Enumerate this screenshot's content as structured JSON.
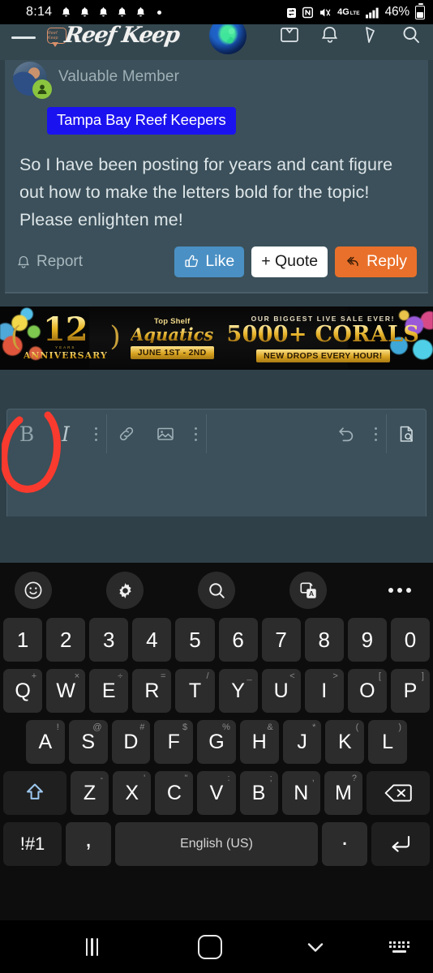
{
  "status_bar": {
    "time": "8:14",
    "notification_icons": [
      "bell-icon",
      "bell-icon",
      "bell-icon",
      "bell-icon",
      "bell-icon",
      "dot-icon"
    ],
    "right_icons": [
      "screen-recorder-icon",
      "nfc-icon",
      "vibrate-mute-icon",
      "4g-lte-icon",
      "signal-bars-icon"
    ],
    "battery_percent": "46%",
    "network_label": "4G",
    "network_sub": "LTE",
    "nfc_label": "N"
  },
  "app_header": {
    "menu_icon": "hamburger-icon",
    "logo_text": "Reef Keep",
    "logo_badge_text": "Reef Keep",
    "globe_icon": "globe-icon",
    "right_icons": [
      "inbox-icon",
      "notification-bell-icon",
      "activity-icon",
      "search-icon"
    ]
  },
  "post": {
    "member_title": "Valuable Member",
    "group_badge": "Tampa Bay Reef Keepers",
    "body": "So I have been posting for years and cant figure out how to make the letters bold for the topic! Please enlighten me!",
    "report_label": "Report",
    "like_label": "Like",
    "quote_label": "+ Quote",
    "reply_label": "Reply",
    "badge_color": "#1b12f0",
    "like_color": "#4a90c4",
    "reply_color": "#e9702a"
  },
  "ad": {
    "years_number": "12",
    "years_word": "YEARS",
    "anniversary": "ANNIVERSARY",
    "brand_top": "Top Shelf",
    "brand_main": "Aquatics",
    "brand_ribbon": "JUNE 1ST - 2ND",
    "sale_top": "OUR BIGGEST LIVE SALE EVER!",
    "sale_main": "5000+ CORALS",
    "sale_ribbon": "NEW DROPS EVERY HOUR!"
  },
  "composer": {
    "bold_label": "B",
    "italic_label": "I",
    "tools": [
      "bold-button",
      "italic-button",
      "text-overflow-button",
      "link-button",
      "image-button",
      "insert-overflow-button",
      "undo-button",
      "history-overflow-button",
      "preview-button"
    ],
    "annotation": "red-circle-highlight-on-bold"
  },
  "keyboard": {
    "toolbar_icons": [
      "emoji-icon",
      "settings-gear-icon",
      "search-icon",
      "translate-icon",
      "more-options-icon"
    ],
    "rows": [
      {
        "name": "number-row",
        "keys": [
          {
            "label": "1",
            "sup": ""
          },
          {
            "label": "2",
            "sup": ""
          },
          {
            "label": "3",
            "sup": ""
          },
          {
            "label": "4",
            "sup": ""
          },
          {
            "label": "5",
            "sup": ""
          },
          {
            "label": "6",
            "sup": ""
          },
          {
            "label": "7",
            "sup": ""
          },
          {
            "label": "8",
            "sup": ""
          },
          {
            "label": "9",
            "sup": ""
          },
          {
            "label": "0",
            "sup": ""
          }
        ]
      },
      {
        "name": "qwerty-row",
        "keys": [
          {
            "label": "Q",
            "sup": "+"
          },
          {
            "label": "W",
            "sup": "×"
          },
          {
            "label": "E",
            "sup": "÷"
          },
          {
            "label": "R",
            "sup": "="
          },
          {
            "label": "T",
            "sup": "/"
          },
          {
            "label": "Y",
            "sup": "_"
          },
          {
            "label": "U",
            "sup": "<"
          },
          {
            "label": "I",
            "sup": ">"
          },
          {
            "label": "O",
            "sup": "["
          },
          {
            "label": "P",
            "sup": "]"
          }
        ]
      },
      {
        "name": "asdf-row",
        "keys": [
          {
            "label": "A",
            "sup": "!"
          },
          {
            "label": "S",
            "sup": "@"
          },
          {
            "label": "D",
            "sup": "#"
          },
          {
            "label": "F",
            "sup": "$"
          },
          {
            "label": "G",
            "sup": "%"
          },
          {
            "label": "H",
            "sup": "&"
          },
          {
            "label": "J",
            "sup": "*"
          },
          {
            "label": "K",
            "sup": "("
          },
          {
            "label": "L",
            "sup": ")"
          }
        ]
      },
      {
        "name": "zxcv-row",
        "keys": [
          {
            "label": "Z",
            "sup": "-"
          },
          {
            "label": "X",
            "sup": "'"
          },
          {
            "label": "C",
            "sup": "\""
          },
          {
            "label": "V",
            "sup": ":"
          },
          {
            "label": "B",
            "sup": ";"
          },
          {
            "label": "N",
            "sup": ","
          },
          {
            "label": "M",
            "sup": "?"
          }
        ]
      }
    ],
    "shift_icon": "shift-arrow-icon",
    "backspace_icon": "backspace-icon",
    "symbols_label": "!#1",
    "comma_label": ",",
    "space_label": "English (US)",
    "period_label": ".",
    "enter_icon": "enter-return-icon"
  },
  "nav_bar": {
    "recents_icon": "recents-icon",
    "home_icon": "home-icon",
    "back_icon": "back-chevron-icon",
    "keyboard_icon": "hide-keyboard-icon"
  }
}
